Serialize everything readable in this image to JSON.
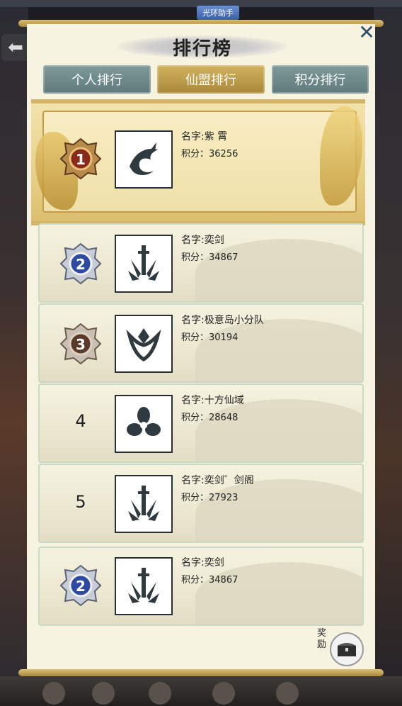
{
  "top_tag": "光环助手",
  "title": "排行榜",
  "tabs": [
    {
      "label": "个人排行",
      "active": false
    },
    {
      "label": "仙盟排行",
      "active": true
    },
    {
      "label": "积分排行",
      "active": false
    }
  ],
  "name_prefix": "名字:",
  "score_prefix": "积分：",
  "rankings": [
    {
      "rank": 1,
      "name": "紫 霄",
      "score": "36256",
      "emblem": "dragon-emblem-icon",
      "medal": "gold"
    },
    {
      "rank": 2,
      "name": "奕剑",
      "score": "34867",
      "emblem": "sword-emblem-icon",
      "medal": "silver-blue"
    },
    {
      "rank": 3,
      "name": "极意岛小分队",
      "score": "30194",
      "emblem": "lotus-emblem-icon",
      "medal": "bronze"
    },
    {
      "rank": 4,
      "name": "十方仙域",
      "score": "28648",
      "emblem": "trefoil-emblem-icon",
      "medal": "none"
    },
    {
      "rank": 5,
      "name": "奕剑゛剑阁",
      "score": "27923",
      "emblem": "sword-emblem-icon",
      "medal": "none"
    },
    {
      "rank": 2,
      "name": "奕剑",
      "score": "34867",
      "emblem": "sword-emblem-icon",
      "medal": "silver-blue"
    }
  ],
  "reward": {
    "label": "奖励",
    "icon": "treasure-chest-icon"
  },
  "colors": {
    "tab_active": "#c2a14c",
    "tab_inactive": "#6e8b8c",
    "panel": "#f7f3e1",
    "close": "#2b4e63"
  }
}
